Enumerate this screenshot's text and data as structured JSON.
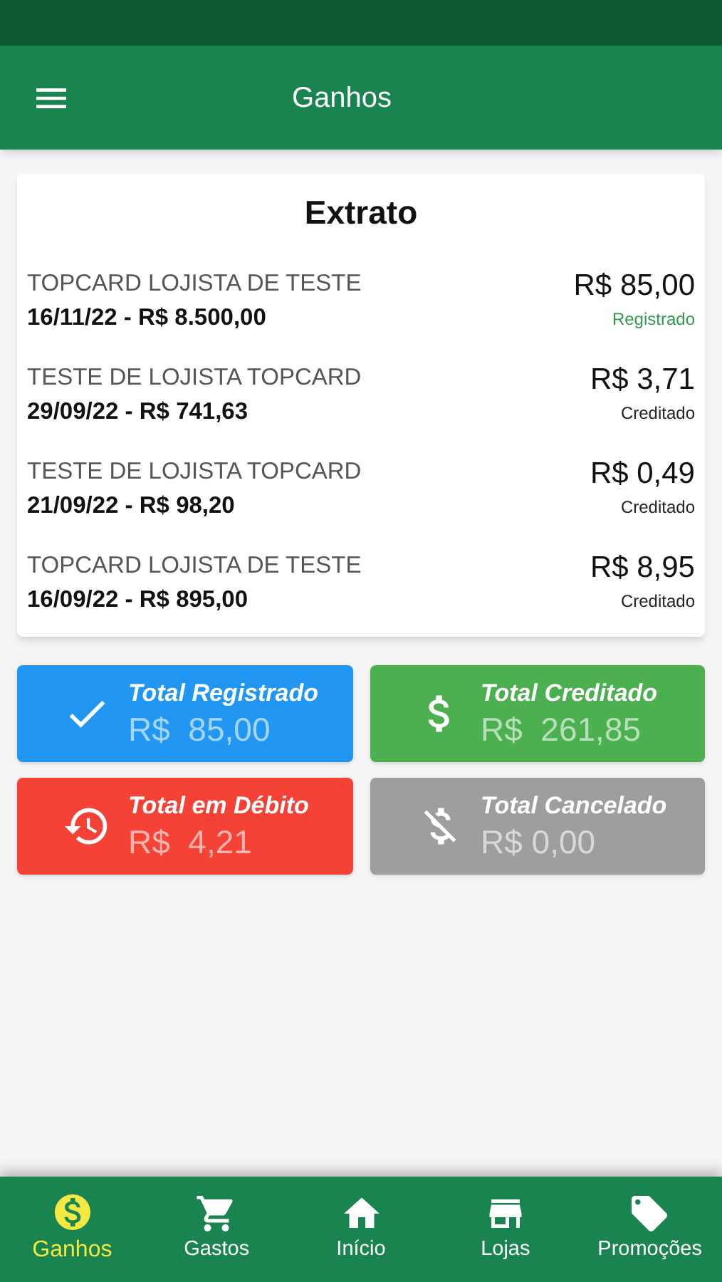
{
  "header": {
    "title": "Ganhos"
  },
  "statement": {
    "title": "Extrato",
    "entries": [
      {
        "store": "TOPCARD LOJISTA DE TESTE",
        "detail": "16/11/22 - R$ 8.500,00",
        "amount": "R$ 85,00",
        "status": "Registrado",
        "kind": "registered"
      },
      {
        "store": "TESTE DE LOJISTA TOPCARD",
        "detail": "29/09/22 - R$ 741,63",
        "amount": "R$ 3,71",
        "status": "Creditado",
        "kind": "credited"
      },
      {
        "store": "TESTE DE LOJISTA TOPCARD",
        "detail": "21/09/22 - R$ 98,20",
        "amount": "R$ 0,49",
        "status": "Creditado",
        "kind": "credited"
      },
      {
        "store": "TOPCARD LOJISTA DE TESTE",
        "detail": "16/09/22 - R$ 895,00",
        "amount": "R$ 8,95",
        "status": "Creditado",
        "kind": "credited"
      }
    ]
  },
  "totals": [
    {
      "label": "Total Registrado",
      "value": "R$  85,00",
      "kind": "registered"
    },
    {
      "label": "Total Creditado",
      "value": "R$  261,85",
      "kind": "credited"
    },
    {
      "label": "Total em Débito",
      "value": "R$  4,21",
      "kind": "debit"
    },
    {
      "label": "Total Cancelado",
      "value": "R$ 0,00",
      "kind": "cancelled"
    }
  ],
  "bottom_nav": [
    {
      "label": "Ganhos",
      "selected": true,
      "kind": "earnings"
    },
    {
      "label": "Gastos",
      "selected": false,
      "kind": "spending"
    },
    {
      "label": "Início",
      "selected": false,
      "kind": "home"
    },
    {
      "label": "Lojas",
      "selected": false,
      "kind": "stores"
    },
    {
      "label": "Promoções",
      "selected": false,
      "kind": "promotions"
    }
  ]
}
